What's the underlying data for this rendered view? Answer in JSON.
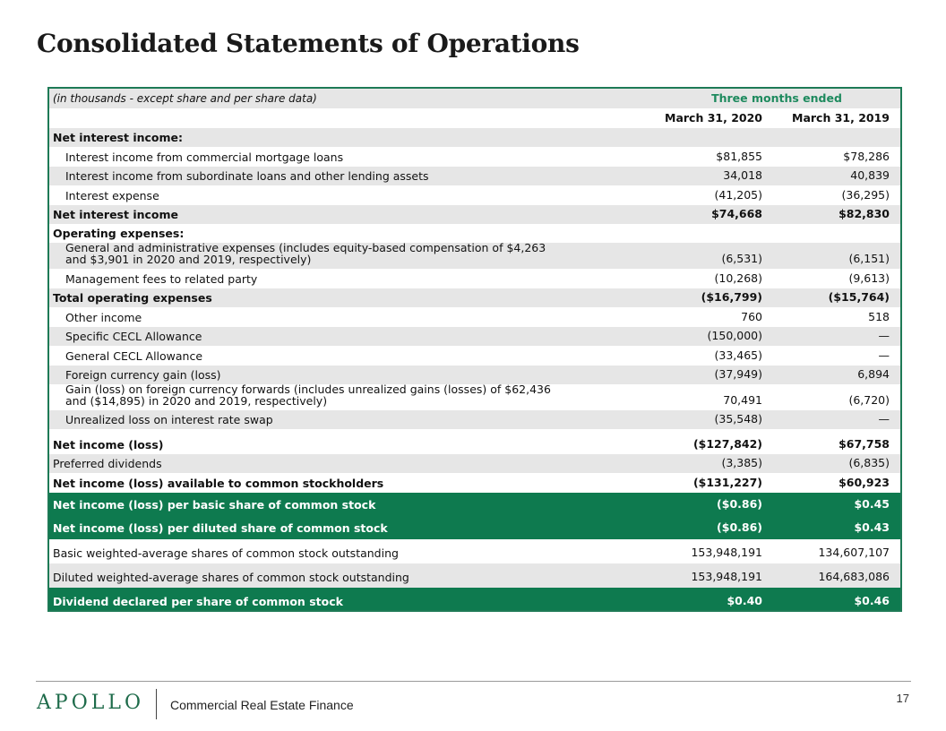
{
  "title": "Consolidated Statements of Operations",
  "header": {
    "units_note": "(in thousands - except share and per share data)",
    "period_group": "Three months ended",
    "col1": "March 31, 2020",
    "col2": "March 31, 2019"
  },
  "rows": [
    {
      "label": "Net interest income:",
      "v1": "",
      "v2": ""
    },
    {
      "label": "Interest income from commercial mortgage loans",
      "v1": "$81,855",
      "v2": "$78,286"
    },
    {
      "label": "Interest income from subordinate loans and other lending assets",
      "v1": "34,018",
      "v2": "40,839"
    },
    {
      "label": "Interest expense",
      "v1": "(41,205)",
      "v2": "(36,295)"
    },
    {
      "label": "Net interest income",
      "v1": "$74,668",
      "v2": "$82,830"
    },
    {
      "label": "Operating expenses:",
      "v1": "",
      "v2": ""
    },
    {
      "label": "General and administrative expenses (includes equity-based compensation of $4,263 and $3,901 in 2020 and 2019, respectively)",
      "v1": "(6,531)",
      "v2": "(6,151)"
    },
    {
      "label": "Management fees to related party",
      "v1": "(10,268)",
      "v2": "(9,613)"
    },
    {
      "label": "Total operating expenses",
      "v1": "($16,799)",
      "v2": "($15,764)"
    },
    {
      "label": "Other income",
      "v1": "760",
      "v2": "518"
    },
    {
      "label": "Specific CECL Allowance",
      "v1": "(150,000)",
      "v2": "—"
    },
    {
      "label": "General CECL Allowance",
      "v1": "(33,465)",
      "v2": "—"
    },
    {
      "label": "Foreign currency gain (loss)",
      "v1": "(37,949)",
      "v2": "6,894"
    },
    {
      "label": "Gain (loss) on foreign currency forwards (includes unrealized gains (losses) of $62,436 and ($14,895) in 2020 and 2019, respectively)",
      "v1": "70,491",
      "v2": "(6,720)"
    },
    {
      "label": "Unrealized loss on interest rate swap",
      "v1": "(35,548)",
      "v2": "—"
    },
    {
      "label": "Net income (loss)",
      "v1": "($127,842)",
      "v2": "$67,758"
    },
    {
      "label": "Preferred dividends",
      "v1": "(3,385)",
      "v2": "(6,835)"
    },
    {
      "label": "Net income (loss) available to common stockholders",
      "v1": "($131,227)",
      "v2": "$60,923"
    },
    {
      "label": "Net income (loss) per basic share of common stock",
      "v1": "($0.86)",
      "v2": "$0.45"
    },
    {
      "label": "Net income (loss) per diluted share of common stock",
      "v1": "($0.86)",
      "v2": "$0.43"
    },
    {
      "label": "Basic weighted-average shares of common stock outstanding",
      "v1": "153,948,191",
      "v2": "134,607,107"
    },
    {
      "label": "Diluted weighted-average shares of common stock outstanding",
      "v1": "153,948,191",
      "v2": "164,683,086"
    },
    {
      "label": "Dividend declared per share of common stock",
      "v1": "$0.40",
      "v2": "$0.46"
    }
  ],
  "footer": {
    "logo": "APOLLO",
    "division": "Commercial Real Estate Finance",
    "page_number": "17"
  },
  "colors": {
    "accent_green": "#0e7a4f",
    "header_green_text": "#1e8a5e",
    "row_gray": "#e6e6e6"
  }
}
